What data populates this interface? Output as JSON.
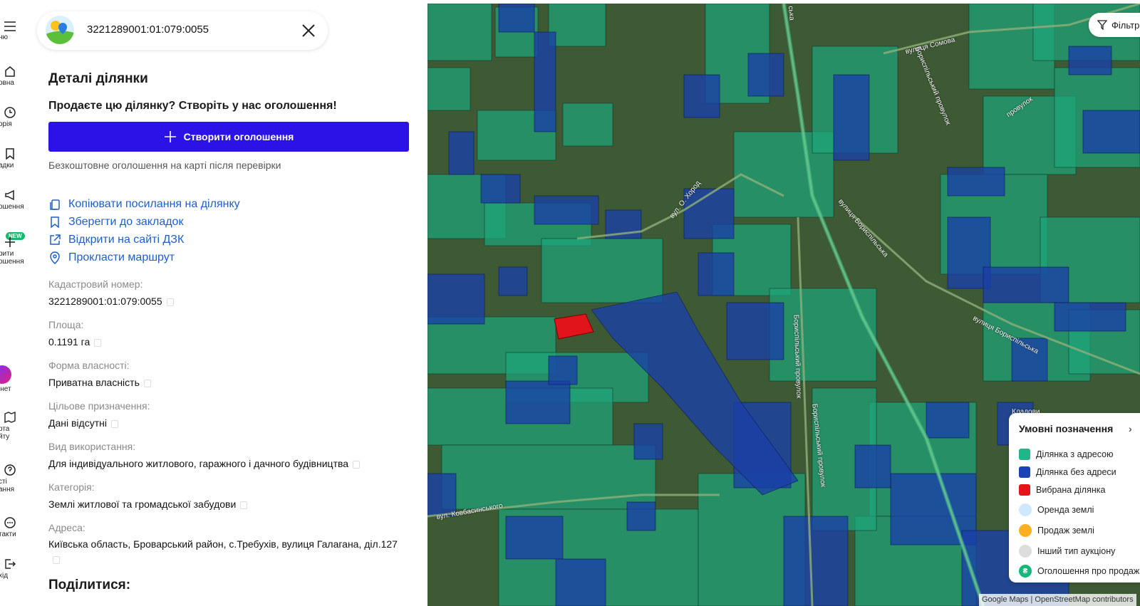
{
  "rail": {
    "items": [
      {
        "label": "ню",
        "icon": "menu-icon"
      },
      {
        "label": "овна",
        "icon": "home-icon"
      },
      {
        "label": "орія",
        "icon": "history-icon"
      },
      {
        "label": "адки",
        "icon": "bookmark-icon"
      },
      {
        "label": "ошення",
        "icon": "megaphone-icon"
      },
      {
        "label": "рити",
        "icon": "plus-icon"
      },
      {
        "label": "ошення",
        "icon": "plus-icon"
      },
      {
        "label": "інет",
        "icon": "avatar"
      },
      {
        "label": "рта",
        "icon": "map-icon"
      },
      {
        "label": "йту",
        "icon": "map-icon"
      },
      {
        "label": "сті",
        "icon": "question-icon"
      },
      {
        "label": "ання",
        "icon": "question-icon"
      },
      {
        "label": "такти",
        "icon": "chat-icon"
      },
      {
        "label": "хід",
        "icon": "logout-icon"
      }
    ],
    "new_badge": "NEW"
  },
  "search": {
    "query": "3221289001:01:079:0055"
  },
  "details": {
    "title": "Деталі ділянки",
    "promo": "Продаєте цю ділянку? Створіть у нас оголошення!",
    "create_button": "Створити оголошення",
    "free_note": "Безкоштовне оголошення на карті після перевірки"
  },
  "links": {
    "copy_link": "Копіювати посилання на ділянку",
    "save_bookmark": "Зберегти до закладок",
    "open_dzk": "Відкрити на сайті ДЗК",
    "route": "Прокласти маршрут"
  },
  "fields": [
    {
      "label": "Кадастровий номер:",
      "value": "3221289001:01:079:0055"
    },
    {
      "label": "Площа:",
      "value": "0.1191 га"
    },
    {
      "label": "Форма власності:",
      "value": "Приватна власність"
    },
    {
      "label": "Цільове призначення:",
      "value": "Дані відсутні"
    },
    {
      "label": "Вид використання:",
      "value": "Для індивідуального житлового, гаражного і дачного будівництва"
    },
    {
      "label": "Категорія:",
      "value": "Землі житлової та громадської забудови"
    },
    {
      "label": "Адреса:",
      "value": "Київська область, Броварський район, с.Требухів, вулиця Галагана, діл.127"
    }
  ],
  "share": {
    "title": "Поділитися:"
  },
  "map": {
    "filter_label": "Фільтр",
    "streets": [
      "вулиця Сомова",
      "Бориспільський провулок",
      "вул. О. Хород",
      "вулиця Бориспільська",
      "вулиця Бориспільська",
      "Бориспільський провулок",
      "Бориспільський провулок",
      "вул. Ковбасинського",
      "Кладови",
      "ська",
      "провулок"
    ],
    "attribution": "Google Maps | OpenStreetMap contributors",
    "colors": {
      "with_address": "#1fa37a",
      "no_address": "#1a3fa8",
      "selected": "#e0141a"
    }
  },
  "legend": {
    "title": "Умовні позначення",
    "items": [
      {
        "label": "Ділянка з адресою",
        "color": "#23b58a",
        "icon": "square-swatch"
      },
      {
        "label": "Ділянка без адреси",
        "color": "#1c40b8",
        "icon": "square-swatch"
      },
      {
        "label": "Вибрана ділянка",
        "color": "#e5141b",
        "icon": "square-swatch"
      },
      {
        "label": "Оренда землі",
        "color": "#cfe7ff",
        "icon": "auction-icon"
      },
      {
        "label": "Продаж землі",
        "color": "#ffb020",
        "icon": "auction-icon"
      },
      {
        "label": "Інший тип аукціону",
        "color": "#dddddd",
        "icon": "auction-icon"
      },
      {
        "label": "Оголошення про продаж",
        "color": "#14b87a",
        "icon": "hryvnia-icon",
        "glyph": "₴"
      }
    ]
  }
}
